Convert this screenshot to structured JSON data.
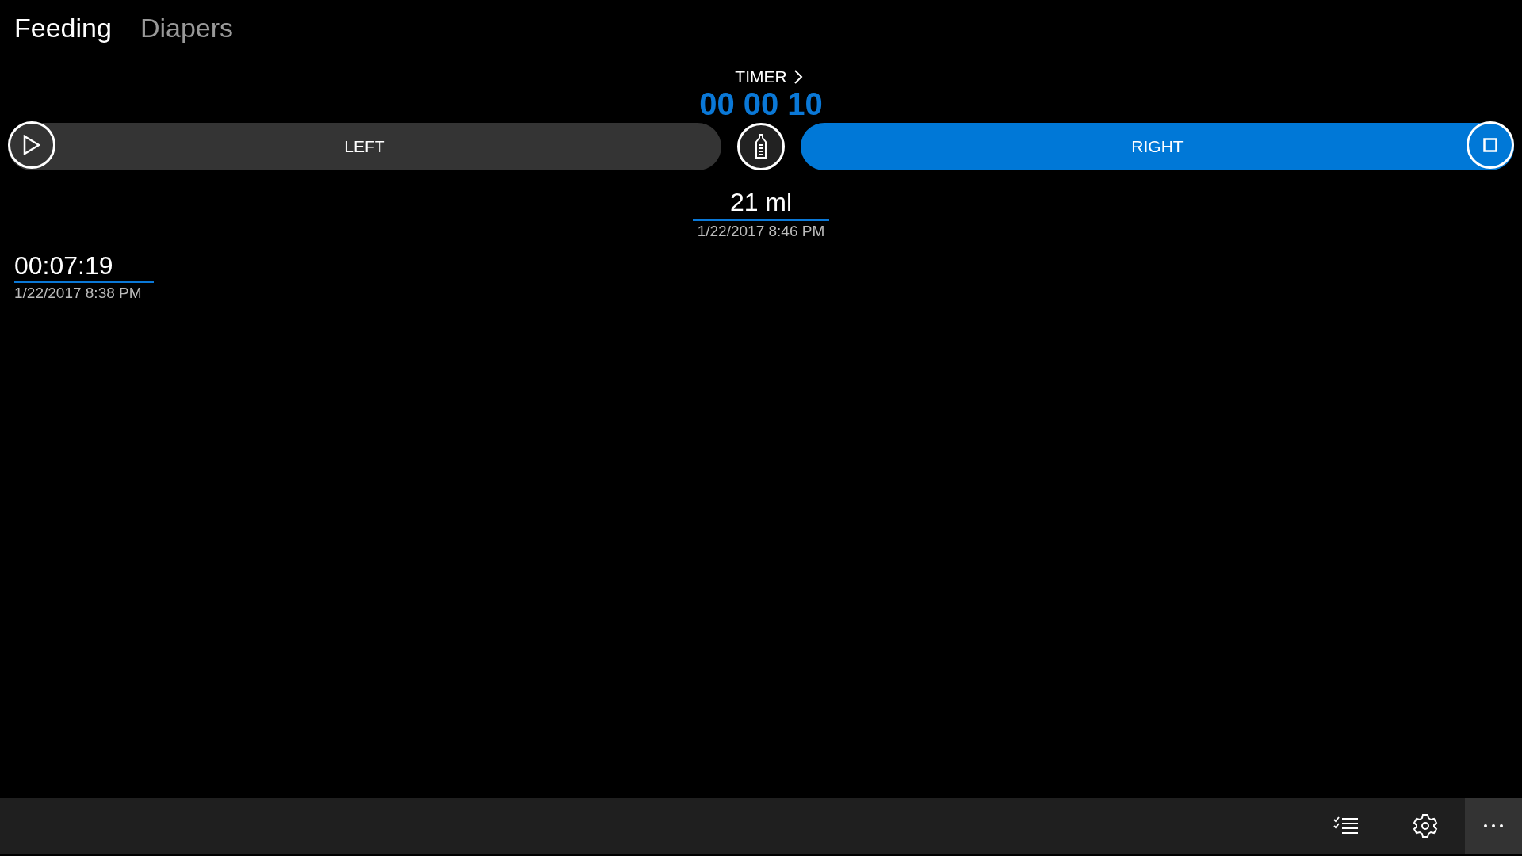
{
  "tabs": [
    {
      "label": "Feeding",
      "selected": true
    },
    {
      "label": "Diapers",
      "selected": false
    }
  ],
  "timer": {
    "label": "TIMER",
    "time": "00 00 10"
  },
  "sides": [
    {
      "label": "LEFT",
      "running": false
    },
    {
      "label": "RIGHT",
      "running": true
    }
  ],
  "entries": [
    {
      "kind": "bottle",
      "value": "21 ml",
      "date": "1/22/2017 8:46 PM"
    },
    {
      "kind": "breast",
      "value": "00:07:19",
      "date": "1/22/2017 8:38 PM"
    }
  ]
}
